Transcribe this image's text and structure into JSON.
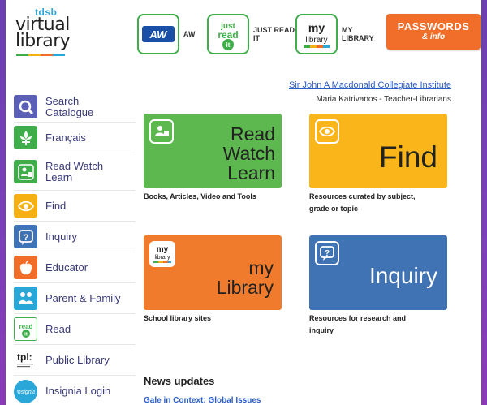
{
  "logo": {
    "brand": "tdsb",
    "line1": "virtual",
    "line2": "library"
  },
  "header": {
    "items": [
      {
        "label": "AW",
        "icon": "aw-logo"
      },
      {
        "label": "JUST READ IT",
        "icon": "just-read-it-logo"
      },
      {
        "label": "MY LIBRARY",
        "icon": "my-library-logo"
      }
    ],
    "passwords": {
      "title": "PASSWORDS",
      "sub": "& info"
    }
  },
  "school": {
    "name": "Sir John A Macdonald Collegiate Institute",
    "staff": "Maria Katrivanos - Teacher-Librarians"
  },
  "sidebar": {
    "items": [
      {
        "label": "Search Catalogue",
        "icon": "magnifier-icon",
        "color": "#5b5fb5"
      },
      {
        "label": "Français",
        "icon": "fleur-de-lis-icon",
        "color": "#3fae4a"
      },
      {
        "label": "Read Watch Learn",
        "icon": "read-watch-learn-icon",
        "color": "#3fae4a"
      },
      {
        "label": "Find",
        "icon": "eye-icon",
        "color": "#f5b114"
      },
      {
        "label": "Inquiry",
        "icon": "question-icon",
        "color": "#3f73b8"
      },
      {
        "label": "Educator",
        "icon": "apple-icon",
        "color": "#f06e2a"
      },
      {
        "label": "Parent & Family",
        "icon": "family-icon",
        "color": "#2aa7d9"
      },
      {
        "label": "Read",
        "icon": "read-it-icon",
        "color": "#3fae4a"
      },
      {
        "label": "Public Library",
        "icon": "tpl-logo",
        "color": "#222222"
      },
      {
        "label": "Insignia Login",
        "icon": "insignia-logo",
        "color": "#2aa7d9"
      }
    ]
  },
  "tiles": {
    "read": {
      "l1": "Read",
      "l2": "Watch",
      "l3": "Learn",
      "caption": "Books, Articles, Video and Tools",
      "color": "#5db84f"
    },
    "find": {
      "l1": "Find",
      "caption1": "Resources curated by subject,",
      "caption2": "grade or topic",
      "color": "#f9b51a"
    },
    "mylib": {
      "l1": "my",
      "l2": "Library",
      "caption": "School library sites",
      "color": "#f07b2c"
    },
    "inquiry": {
      "l1": "Inquiry",
      "caption1": "Resources for research and",
      "caption2": "inquiry",
      "color": "#3f73b4"
    }
  },
  "news": {
    "title": "News updates",
    "first": "Gale in Context: Global Issues"
  }
}
